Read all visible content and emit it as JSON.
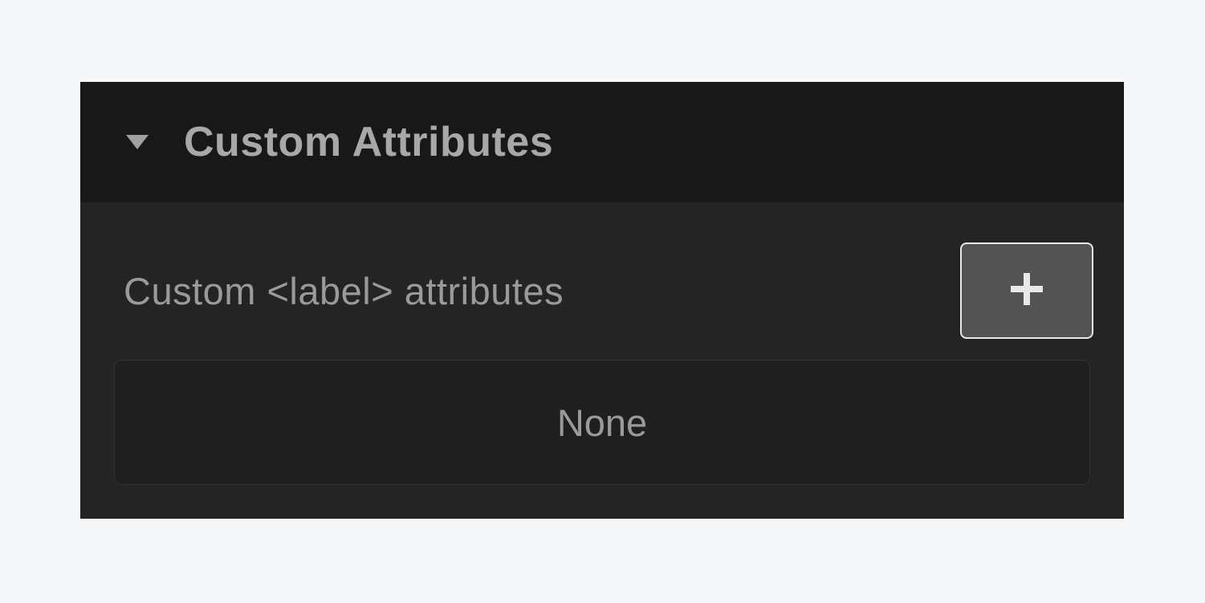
{
  "section": {
    "title": "Custom Attributes",
    "row_label": "Custom <label> attributes",
    "add_icon": "plus-icon",
    "value": "None"
  }
}
